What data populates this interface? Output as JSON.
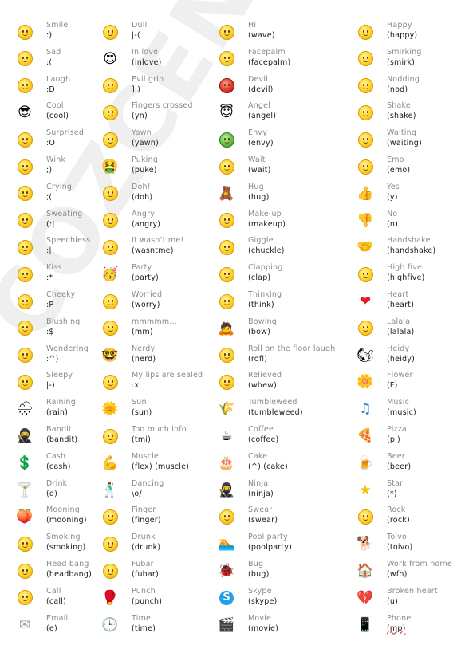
{
  "watermark": "COZCENTER.COM",
  "columns": [
    [
      {
        "name": "Smile",
        "code": ":)",
        "icon": "smile-icon",
        "glyph": "face"
      },
      {
        "name": "Sad",
        "code": ":(",
        "icon": "sad-icon",
        "glyph": "face"
      },
      {
        "name": "Laugh",
        "code": ":D",
        "icon": "laugh-icon",
        "glyph": "face"
      },
      {
        "name": "Cool",
        "code": "(cool)",
        "icon": "sunglasses-face-icon",
        "glyph": "😎"
      },
      {
        "name": "Surprised",
        "code": ":O",
        "icon": "surprised-icon",
        "glyph": "face"
      },
      {
        "name": "Wink",
        "code": ";)",
        "icon": "wink-icon",
        "glyph": "face"
      },
      {
        "name": "Crying",
        "code": ";(",
        "icon": "crying-icon",
        "glyph": "face"
      },
      {
        "name": "Sweating",
        "code": "(:|",
        "icon": "sweating-icon",
        "glyph": "face"
      },
      {
        "name": "Speechless",
        "code": ":|",
        "icon": "speechless-icon",
        "glyph": "face"
      },
      {
        "name": "Kiss",
        "code": ":*",
        "icon": "kiss-icon",
        "glyph": "face"
      },
      {
        "name": "Cheeky",
        "code": ":P",
        "icon": "cheeky-icon",
        "glyph": "face"
      },
      {
        "name": "Blushing",
        "code": ":$",
        "icon": "blushing-icon",
        "glyph": "face"
      },
      {
        "name": "Wondering",
        "code": ":^)",
        "icon": "wondering-icon",
        "glyph": "face"
      },
      {
        "name": "Sleepy",
        "code": "|-)",
        "icon": "sleepy-icon",
        "glyph": "face"
      },
      {
        "name": "Raining",
        "code": "(rain)",
        "icon": "rain-cloud-icon",
        "glyph": "🌧"
      },
      {
        "name": "Bandit",
        "code": "(bandit)",
        "icon": "bandit-icon",
        "glyph": "🥷"
      },
      {
        "name": "Cash",
        "code": "(cash)",
        "icon": "dollar-sign-icon",
        "glyph": "💲"
      },
      {
        "name": "Drink",
        "code": "(d)",
        "icon": "cocktail-icon",
        "glyph": "🍸"
      },
      {
        "name": "Mooning",
        "code": "(mooning)",
        "icon": "mooning-icon",
        "glyph": "🍑"
      },
      {
        "name": "Smoking",
        "code": "(smoking)",
        "icon": "smoking-icon",
        "glyph": "face"
      },
      {
        "name": "Head bang",
        "code": "(headbang)",
        "icon": "headbang-icon",
        "glyph": "face"
      },
      {
        "name": "Call",
        "code": "(call)",
        "icon": "call-icon",
        "glyph": "face"
      },
      {
        "name": "Email",
        "code": "(e)",
        "icon": "envelope-icon",
        "glyph": "✉"
      }
    ],
    [
      {
        "name": "Dull",
        "code": "|-(",
        "icon": "dull-icon",
        "glyph": "face"
      },
      {
        "name": "In love",
        "code": "(inlove)",
        "icon": "in-love-icon",
        "glyph": "😍"
      },
      {
        "name": "Evil grin",
        "code": "]:)",
        "icon": "evil-grin-icon",
        "glyph": "face"
      },
      {
        "name": "Fingers crossed",
        "code": "(yn)",
        "icon": "fingers-crossed-icon",
        "glyph": "face"
      },
      {
        "name": "Yawn",
        "code": "(yawn)",
        "icon": "yawn-icon",
        "glyph": "face"
      },
      {
        "name": "Puking",
        "code": "(puke)",
        "icon": "puking-icon",
        "glyph": "🤮"
      },
      {
        "name": "Doh!",
        "code": "(doh)",
        "icon": "doh-icon",
        "glyph": "face"
      },
      {
        "name": "Angry",
        "code": "(angry)",
        "icon": "angry-icon",
        "glyph": "face"
      },
      {
        "name": "It wasn’t me!",
        "code": "(wasntme)",
        "icon": "wasntme-icon",
        "glyph": "face"
      },
      {
        "name": "Party",
        "code": "(party)",
        "icon": "party-icon",
        "glyph": "🥳"
      },
      {
        "name": "Worried",
        "code": "(worry)",
        "icon": "worried-icon",
        "glyph": "face"
      },
      {
        "name": "mmmmm…",
        "code": "(mm)",
        "icon": "mm-icon",
        "glyph": "face"
      },
      {
        "name": "Nerdy",
        "code": "(nerd)",
        "icon": "nerd-icon",
        "glyph": "🤓"
      },
      {
        "name": "My lips are sealed",
        "code": ":x",
        "icon": "lips-sealed-icon",
        "glyph": "face"
      },
      {
        "name": "Sun",
        "code": "(sun)",
        "icon": "sun-icon",
        "glyph": "🌞"
      },
      {
        "name": "Too much info",
        "code": "(tmi)",
        "icon": "tmi-icon",
        "glyph": "face"
      },
      {
        "name": "Muscle",
        "code": "(flex) (muscle)",
        "icon": "muscle-arm-icon",
        "glyph": "💪"
      },
      {
        "name": "Dancing",
        "code": "\\o/",
        "icon": "dancing-icon",
        "glyph": "🕺"
      },
      {
        "name": "Finger",
        "code": "(finger)",
        "icon": "finger-icon",
        "glyph": "face"
      },
      {
        "name": "Drunk",
        "code": "(drunk)",
        "icon": "drunk-icon",
        "glyph": "face"
      },
      {
        "name": "Fubar",
        "code": "(fubar)",
        "icon": "fubar-icon",
        "glyph": "face"
      },
      {
        "name": "Punch",
        "code": "(punch)",
        "icon": "boxing-glove-icon",
        "glyph": "🥊"
      },
      {
        "name": "Time",
        "code": "(time)",
        "icon": "clock-icon",
        "glyph": "🕒"
      }
    ],
    [
      {
        "name": "Hi",
        "code": "(wave)",
        "icon": "wave-icon",
        "glyph": "face"
      },
      {
        "name": "Facepalm",
        "code": "(facepalm)",
        "icon": "facepalm-icon",
        "glyph": "face"
      },
      {
        "name": "Devil",
        "code": "(devil)",
        "icon": "devil-icon",
        "glyph": "red"
      },
      {
        "name": "Angel",
        "code": "(angel)",
        "icon": "angel-icon",
        "glyph": "😇"
      },
      {
        "name": "Envy",
        "code": "(envy)",
        "icon": "envy-icon",
        "glyph": "green"
      },
      {
        "name": "Wait",
        "code": "(wait)",
        "icon": "wait-icon",
        "glyph": "face"
      },
      {
        "name": "Hug",
        "code": "(hug)",
        "icon": "teddy-bear-icon",
        "glyph": "🧸"
      },
      {
        "name": "Make-up",
        "code": "(makeup)",
        "icon": "makeup-icon",
        "glyph": "face"
      },
      {
        "name": "Giggle",
        "code": "(chuckle)",
        "icon": "giggle-icon",
        "glyph": "face"
      },
      {
        "name": "Clapping",
        "code": "(clap)",
        "icon": "clapping-icon",
        "glyph": "face"
      },
      {
        "name": "Thinking",
        "code": "(think)",
        "icon": "thinking-icon",
        "glyph": "face"
      },
      {
        "name": "Bowing",
        "code": "(bow)",
        "icon": "bowing-man-icon",
        "glyph": "🙇"
      },
      {
        "name": "Roll on the floor laugh",
        "code": "(rofl)",
        "icon": "rofl-icon",
        "glyph": "face"
      },
      {
        "name": "Relieved",
        "code": "(whew)",
        "icon": "relieved-icon",
        "glyph": "face"
      },
      {
        "name": "Tumbleweed",
        "code": "(tumbleweed)",
        "icon": "tumbleweed-icon",
        "glyph": "🌾"
      },
      {
        "name": "Coffee",
        "code": "(coffee)",
        "icon": "coffee-mug-icon",
        "glyph": "☕"
      },
      {
        "name": "Cake",
        "code": "(^) (cake)",
        "icon": "birthday-cake-icon",
        "glyph": "🎂"
      },
      {
        "name": "Ninja",
        "code": "(ninja)",
        "icon": "ninja-icon",
        "glyph": "🥷"
      },
      {
        "name": "Swear",
        "code": "(swear)",
        "icon": "swear-icon",
        "glyph": "face"
      },
      {
        "name": "Pool party",
        "code": "(poolparty)",
        "icon": "pool-party-icon",
        "glyph": "🏊"
      },
      {
        "name": "Bug",
        "code": "(bug)",
        "icon": "bug-icon",
        "glyph": "🐞"
      },
      {
        "name": "Skype",
        "code": "(skype)",
        "icon": "skype-logo-icon",
        "glyph": "S"
      },
      {
        "name": "Movie",
        "code": "(movie)",
        "icon": "clapperboard-icon",
        "glyph": "🎬"
      }
    ],
    [
      {
        "name": "Happy",
        "code": "(happy)",
        "icon": "happy-icon",
        "glyph": "face"
      },
      {
        "name": "Smirking",
        "code": "(smirk)",
        "icon": "smirk-icon",
        "glyph": "face"
      },
      {
        "name": "Nodding",
        "code": "(nod)",
        "icon": "nodding-icon",
        "glyph": "face"
      },
      {
        "name": "Shake",
        "code": "(shake)",
        "icon": "shake-icon",
        "glyph": "face"
      },
      {
        "name": "Waiting",
        "code": "(waiting)",
        "icon": "waiting-icon",
        "glyph": "face"
      },
      {
        "name": "Emo",
        "code": "(emo)",
        "icon": "emo-icon",
        "glyph": "face"
      },
      {
        "name": "Yes",
        "code": "(y)",
        "icon": "thumbs-up-icon",
        "glyph": "👍"
      },
      {
        "name": "No",
        "code": "(n)",
        "icon": "thumbs-down-icon",
        "glyph": "👎"
      },
      {
        "name": "Handshake",
        "code": "(handshake)",
        "icon": "handshake-icon",
        "glyph": "🤝"
      },
      {
        "name": "High five",
        "code": "(highfive)",
        "icon": "high-five-icon",
        "glyph": "face"
      },
      {
        "name": "Heart",
        "code": "(heart)",
        "icon": "heart-icon",
        "glyph": "❤"
      },
      {
        "name": "Lalala",
        "code": "(lalala)",
        "icon": "lalala-icon",
        "glyph": "face"
      },
      {
        "name": "Heidy",
        "code": "(heidy)",
        "icon": "squirrel-icon",
        "glyph": "🐿"
      },
      {
        "name": "Flower",
        "code": "(F)",
        "icon": "flower-icon",
        "glyph": "🌼"
      },
      {
        "name": "Music",
        "code": "(music)",
        "icon": "music-note-icon",
        "glyph": "♫"
      },
      {
        "name": "Pizza",
        "code": "(pi)",
        "icon": "pizza-icon",
        "glyph": "🍕"
      },
      {
        "name": "Beer",
        "code": "(beer)",
        "icon": "beer-mug-icon",
        "glyph": "🍺"
      },
      {
        "name": "Star",
        "code": "(*)",
        "icon": "star-icon",
        "glyph": "★"
      },
      {
        "name": "Rock",
        "code": "(rock)",
        "icon": "rock-icon",
        "glyph": "face"
      },
      {
        "name": "Toivo",
        "code": "(toivo)",
        "icon": "toivo-icon",
        "glyph": "🐕"
      },
      {
        "name": "Work from home",
        "code": "(wfh)",
        "icon": "house-icon",
        "glyph": "🏠"
      },
      {
        "name": "Broken heart",
        "code": "(u)",
        "icon": "broken-heart-icon",
        "glyph": "💔"
      },
      {
        "name": "Phone",
        "code": "(mp)",
        "icon": "mobile-phone-icon",
        "glyph": "📱",
        "spellcheck": true
      }
    ]
  ]
}
